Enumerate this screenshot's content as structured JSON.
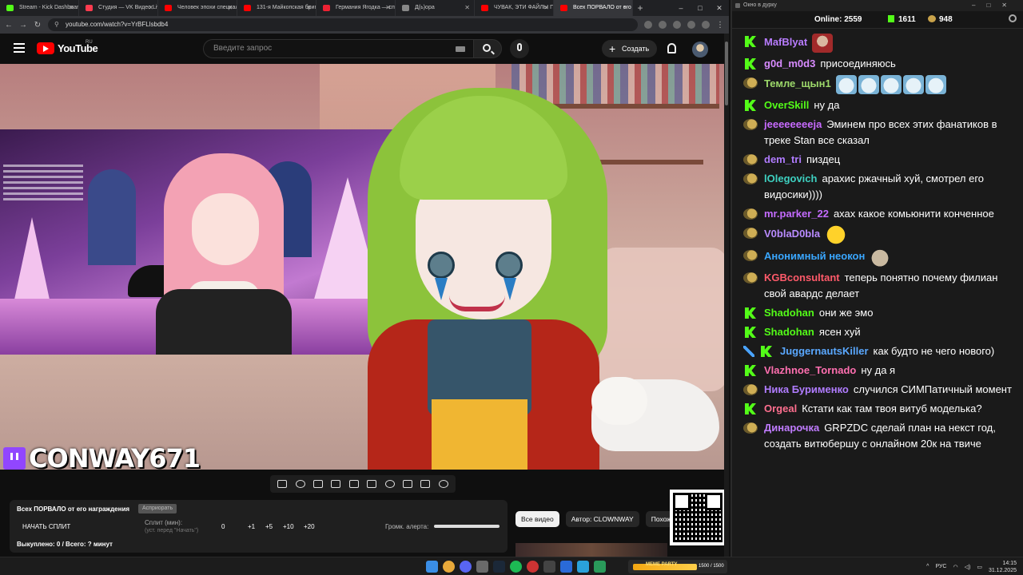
{
  "browser": {
    "tabs": [
      {
        "label": "Stream - Kick Dashboard",
        "color": "#53fc18"
      },
      {
        "label": "Студия — VK Видео Live",
        "color": "#ff3b4f"
      },
      {
        "label": "Человек эпохи специального",
        "color": "#ff0000"
      },
      {
        "label": "131-я Майкопская бригада",
        "color": "#ff0000"
      },
      {
        "label": "Германия Ягодка — спасибо",
        "color": "#e23"
      },
      {
        "label": "Д(ь)ора",
        "color": "#888"
      },
      {
        "label": "ЧУВАК, ЭТИ ФАЙЛЫ ПОКАЖУТ",
        "color": "#ff0000"
      },
      {
        "label": "Всех ПОРВАЛО от его награждения",
        "color": "#ff0000",
        "active": true
      }
    ],
    "url": "youtube.com/watch?v=YrBFLlsbdb4"
  },
  "youtube": {
    "logo_text": "YouTube",
    "region": "RU",
    "search_placeholder": "Введите запрос",
    "create_label": "Создать",
    "video": {
      "channel_overlay": "CONWAY671"
    },
    "chips": [
      "Все видео",
      "Автор: CLOWNWAY",
      "Похож"
    ]
  },
  "extension": {
    "title": "Всех ПОРВАЛО от его награждения",
    "chip": "Асприорать",
    "start_split": "НАЧАТЬ СПЛИТ",
    "split_label": "Сплит (мин):",
    "split_hint": "(уст. перед \"Начать\")",
    "split_value": "0",
    "increments": [
      "+1",
      "+5",
      "+10",
      "+20"
    ],
    "alert_volume_label": "Громк. алерта:",
    "alert_volume_fraction": 1.0,
    "bought": "Выкуплено: 0 / Всего: ? минут"
  },
  "chat": {
    "window_title": "Окно в дурку",
    "online_label": "Online:",
    "online_count": "2559",
    "kick_count": "1611",
    "twitch_count": "948",
    "messages": [
      {
        "badges": [
          "kick"
        ],
        "user": "MafBlyat",
        "color": "#b87cff",
        "text": "",
        "emotes": [
          "man"
        ]
      },
      {
        "badges": [
          "kick"
        ],
        "user": "g0d_m0d3",
        "color": "#d88bff",
        "text": "присоединяюсь"
      },
      {
        "badges": [
          "tw"
        ],
        "user": "Темле_щын1",
        "color": "#9dd96a",
        "text": "",
        "emotes": [
          "cat",
          "cat",
          "cat",
          "cat",
          "cat"
        ]
      },
      {
        "badges": [
          "kick"
        ],
        "user": "OverSkill",
        "color": "#53fc18",
        "text": "ну да"
      },
      {
        "badges": [
          "tw"
        ],
        "user": "jeeeeeeeeja",
        "color": "#c86bff",
        "text": "Эминем про всех этих фанатиков в треке Stan все сказал"
      },
      {
        "badges": [
          "tw"
        ],
        "user": "dem_tri",
        "color": "#b07cff",
        "text": "пиздец"
      },
      {
        "badges": [
          "tw"
        ],
        "user": "lOlegovich",
        "color": "#3ed1c1",
        "text": "арахис ржачный хуй, смотрел его видосики))))"
      },
      {
        "badges": [
          "tw"
        ],
        "user": "mr.parker_22",
        "color": "#c46bff",
        "text": "ахах какое комьюнити конченное"
      },
      {
        "badges": [
          "tw"
        ],
        "user": "V0blaD0bla",
        "color": "#b98bff",
        "text": "",
        "emotes": [
          "smile"
        ]
      },
      {
        "badges": [
          "tw"
        ],
        "user": "Анонимный неокон",
        "color": "#3aa7ff",
        "text": "",
        "emotes": [
          "beaver"
        ]
      },
      {
        "badges": [
          "tw"
        ],
        "user": "KGBconsultant",
        "color": "#ff5a6a",
        "text": "теперь понятно почему филиан свой авардс делает"
      },
      {
        "badges": [
          "kick"
        ],
        "user": "Shadohan",
        "color": "#53fc18",
        "text": "они же эмо"
      },
      {
        "badges": [
          "kick"
        ],
        "user": "Shadohan",
        "color": "#53fc18",
        "text": "ясен хуй"
      },
      {
        "badges": [
          "sword",
          "kick"
        ],
        "user": "JuggernautsKiller",
        "color": "#5aa8ff",
        "text": "как будто не чего нового)"
      },
      {
        "badges": [
          "kick"
        ],
        "user": "Vlazhnoe_Tornado",
        "color": "#ff6fb0",
        "text": "ну да я"
      },
      {
        "badges": [
          "tw"
        ],
        "user": "Ника Бурименко",
        "color": "#b07cff",
        "text": "случился СИМПатичный момент"
      },
      {
        "badges": [
          "kick"
        ],
        "user": "Orgeal",
        "color": "#ff6f8f",
        "text": "Кстати как там твоя витуб моделька?"
      },
      {
        "badges": [
          "tw"
        ],
        "user": "Динарочка",
        "color": "#c07cff",
        "text": "GRPZDC сделай план на некст год, создать витюбершу с онлайном 20к на твиче"
      }
    ]
  },
  "taskbar": {
    "meme_label": "MEME PARTY",
    "meme_count": "1500 / 1500",
    "lang": "РУС",
    "time": "14:15",
    "date": "31.12.2025"
  }
}
